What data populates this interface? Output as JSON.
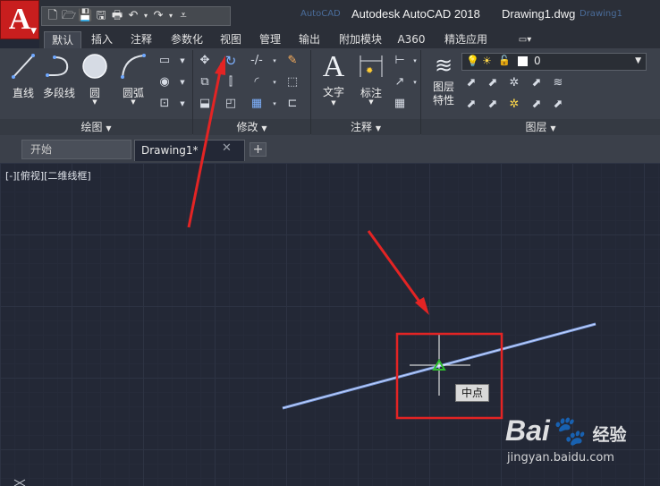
{
  "window": {
    "app_title": "Autodesk AutoCAD 2018",
    "file_title": "Drawing1.dwg",
    "app_letter": "A",
    "ghost_tab_left": "AutoCAD",
    "ghost_tab_right": "Drawing1"
  },
  "quick_access": {
    "icons": [
      "new-icon",
      "open-icon",
      "save-icon",
      "save-as-icon",
      "print-icon",
      "undo-icon",
      "redo-icon",
      "more-icon"
    ]
  },
  "ribbon_tabs": [
    "默认",
    "插入",
    "注释",
    "参数化",
    "视图",
    "管理",
    "输出",
    "附加模块",
    "A360",
    "精选应用"
  ],
  "ribbon_tab_active": "默认",
  "panels": {
    "draw": {
      "title": "绘图",
      "buttons": [
        "直线",
        "多段线",
        "圆",
        "圆弧"
      ]
    },
    "modify": {
      "title": "修改"
    },
    "annotation": {
      "title": "注释",
      "buttons": [
        "文字",
        "标注"
      ]
    },
    "layers": {
      "title": "图层",
      "button": "图层",
      "button_line2": "特性",
      "current_layer": "0"
    }
  },
  "file_tabs": {
    "start": "开始",
    "drawing": "Drawing1*",
    "close": "✕",
    "add": "+"
  },
  "canvas": {
    "view_label": "[-][俯视][二维线框]",
    "tooltip": "中点",
    "bottom_mark": "Y"
  },
  "watermark": {
    "logo": "Bai🐾",
    "jingyan": "经验",
    "url": "jingyan.baidu.com"
  },
  "colors": {
    "canvas_bg": "#232836",
    "annotation_red": "#e32424",
    "line_blue": "#a9c4f5",
    "midpoint_green": "#2fbf2f"
  }
}
